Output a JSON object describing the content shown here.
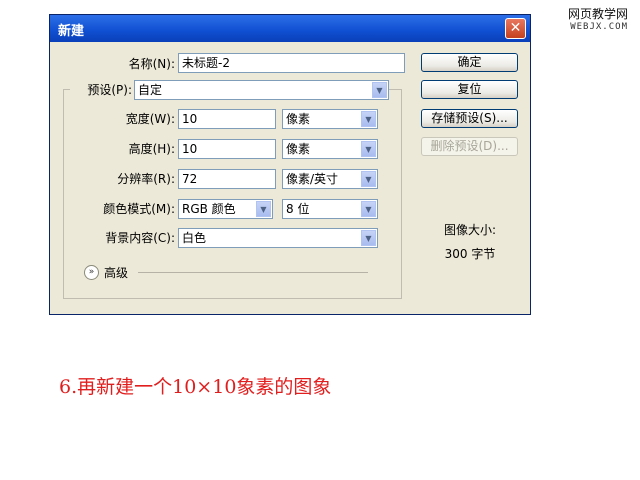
{
  "watermark": {
    "line1": "网页教学网",
    "line2": "WEBJX.COM"
  },
  "dialog": {
    "title": "新建",
    "name_label": "名称(N):",
    "name_value": "未标题-2",
    "preset_label": "预设(P):",
    "preset_value": "自定",
    "width_label": "宽度(W):",
    "width_value": "10",
    "width_unit": "像素",
    "height_label": "高度(H):",
    "height_value": "10",
    "height_unit": "像素",
    "resolution_label": "分辨率(R):",
    "resolution_value": "72",
    "resolution_unit": "像素/英寸",
    "colormode_label": "颜色模式(M):",
    "colormode_value": "RGB 颜色",
    "bitdepth_value": "8 位",
    "background_label": "背景内容(C):",
    "background_value": "白色",
    "advanced_label": "高级",
    "image_size_label": "图像大小:",
    "image_size_value": "300 字节"
  },
  "buttons": {
    "ok": "确定",
    "reset": "复位",
    "save_preset": "存储预设(S)...",
    "delete_preset": "删除预设(D)..."
  },
  "caption": "6.再新建一个10×10象素的图象",
  "colors": {
    "titlebar": "#0f4fd1",
    "dialog_bg": "#ece9d8",
    "caption": "#e11e1e"
  }
}
